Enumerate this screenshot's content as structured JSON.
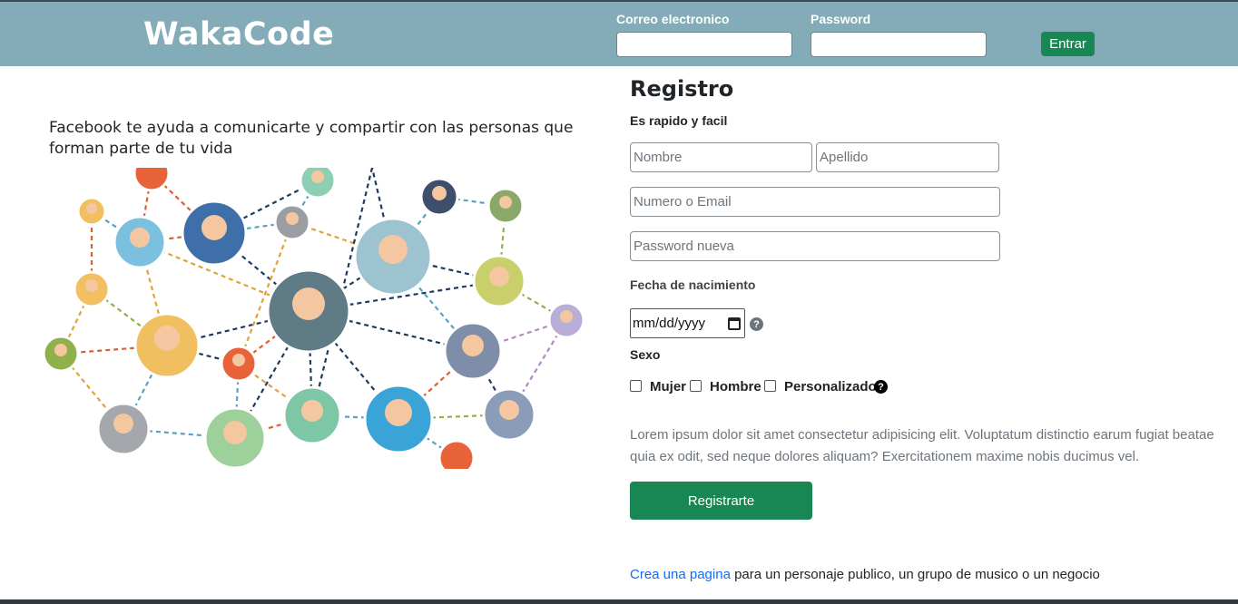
{
  "brand": "WakaCode",
  "login": {
    "email_label": "Correo electronico",
    "password_label": "Password",
    "submit_label": "Entrar"
  },
  "hero": {
    "tagline": "Facebook te ayuda a comunicarte y compartir con las personas que forman parte de tu vida"
  },
  "register": {
    "title": "Registro",
    "subtitle": "Es rapido y facil",
    "first_name_placeholder": "Nombre",
    "last_name_placeholder": "Apellido",
    "contact_placeholder": "Numero o Email",
    "password_placeholder": "Password nueva",
    "birthdate_label": "Fecha de nacimiento",
    "birthdate_placeholder": "mm/dd/yyyy",
    "sex_label": "Sexo",
    "sex_options": [
      "Mujer",
      "Hombre",
      "Personalizado"
    ],
    "help_glyph": "?",
    "terms_text": "Lorem ipsum dolor sit amet consectetur adipisicing elit. Voluptatum distinctio earum fugiat beatae quia ex odit, sed neque dolores aliquam? Exercitationem maxime nobis ducimus vel.",
    "submit_label": "Registrarte"
  },
  "footer": {
    "link_text": "Crea una pagina",
    "rest_text": " para un personaje publico, un grupo de musico o un negocio"
  },
  "colors": {
    "navbar": "#84abb8",
    "primary_button": "#198754",
    "link": "#0d6efd",
    "muted_text": "#6c757d"
  }
}
